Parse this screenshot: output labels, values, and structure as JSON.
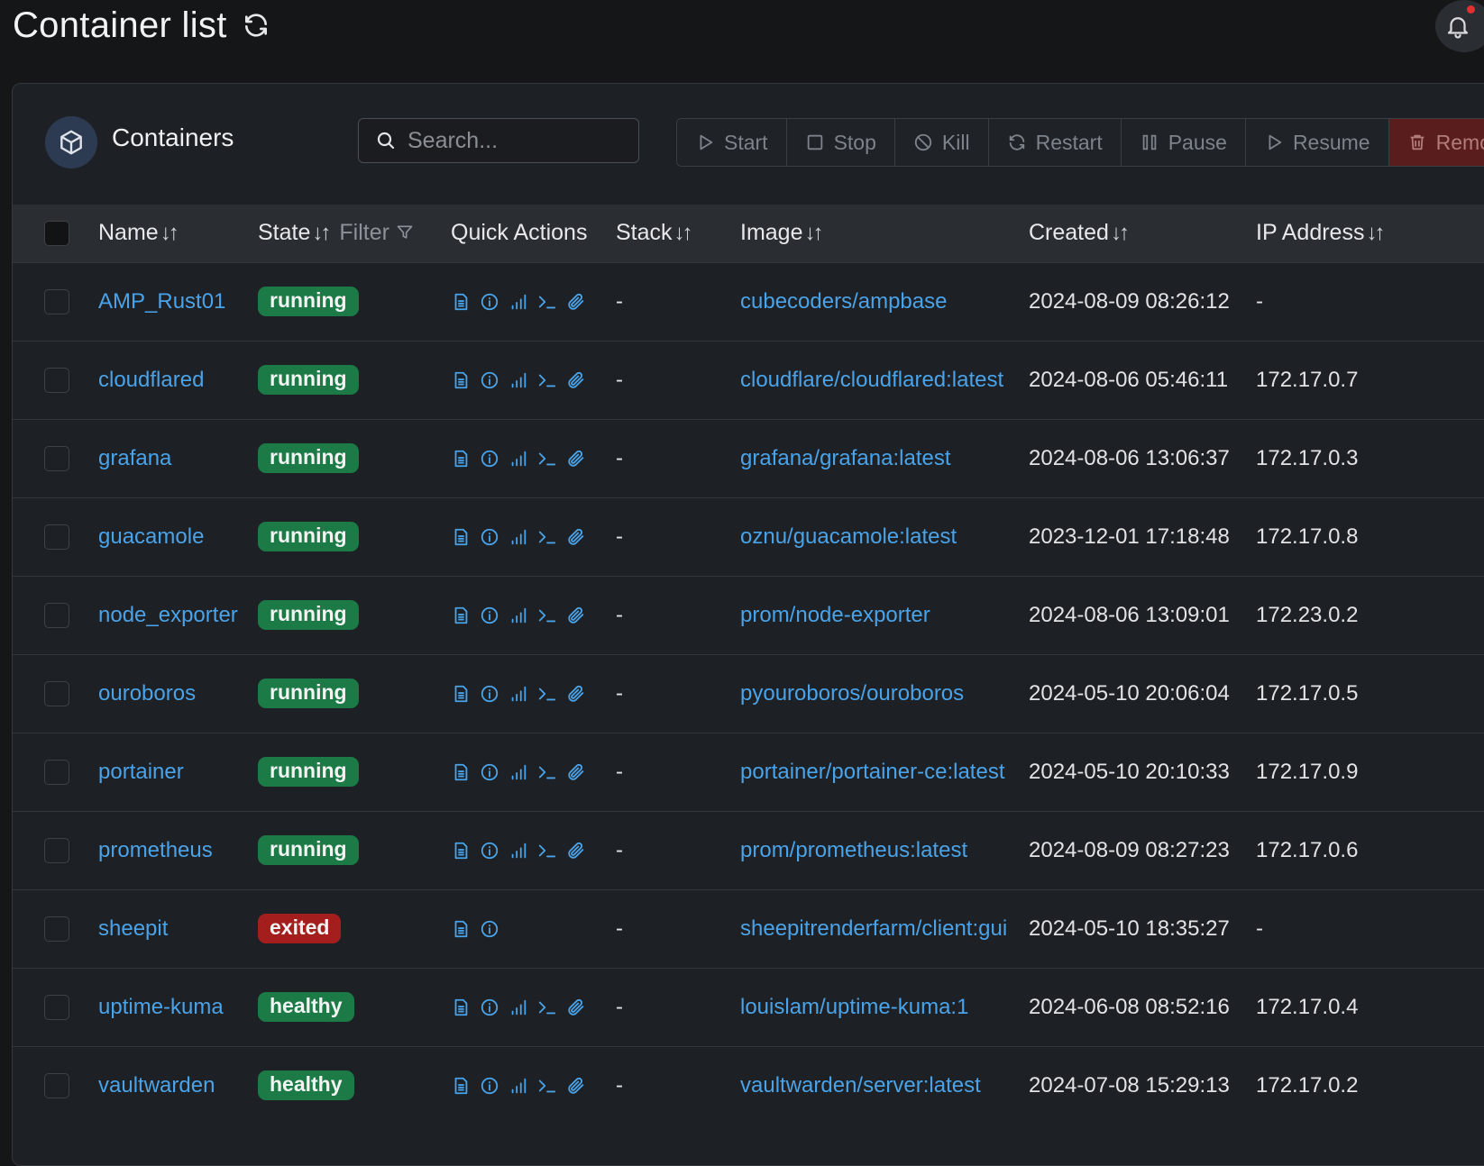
{
  "page": {
    "title": "Container list"
  },
  "panel": {
    "title": "Containers",
    "search": {
      "placeholder": "Search...",
      "value": ""
    },
    "actions": {
      "start": "Start",
      "stop": "Stop",
      "kill": "Kill",
      "restart": "Restart",
      "pause": "Pause",
      "resume": "Resume",
      "remove": "Remove"
    }
  },
  "columns": {
    "name": "Name",
    "state": "State",
    "filter": "Filter",
    "quick_actions": "Quick Actions",
    "stack": "Stack",
    "image": "Image",
    "created": "Created",
    "ip": "IP Address"
  },
  "containers": [
    {
      "name": "AMP_Rust01",
      "state": "running",
      "stack": "-",
      "image": "cubecoders/ampbase",
      "created": "2024-08-09 08:26:12",
      "ip": "-"
    },
    {
      "name": "cloudflared",
      "state": "running",
      "stack": "-",
      "image": "cloudflare/cloudflared:latest",
      "created": "2024-08-06 05:46:11",
      "ip": "172.17.0.7"
    },
    {
      "name": "grafana",
      "state": "running",
      "stack": "-",
      "image": "grafana/grafana:latest",
      "created": "2024-08-06 13:06:37",
      "ip": "172.17.0.3"
    },
    {
      "name": "guacamole",
      "state": "running",
      "stack": "-",
      "image": "oznu/guacamole:latest",
      "created": "2023-12-01 17:18:48",
      "ip": "172.17.0.8"
    },
    {
      "name": "node_exporter",
      "state": "running",
      "stack": "-",
      "image": "prom/node-exporter",
      "created": "2024-08-06 13:09:01",
      "ip": "172.23.0.2"
    },
    {
      "name": "ouroboros",
      "state": "running",
      "stack": "-",
      "image": "pyouroboros/ouroboros",
      "created": "2024-05-10 20:06:04",
      "ip": "172.17.0.5"
    },
    {
      "name": "portainer",
      "state": "running",
      "stack": "-",
      "image": "portainer/portainer-ce:latest",
      "created": "2024-05-10 20:10:33",
      "ip": "172.17.0.9"
    },
    {
      "name": "prometheus",
      "state": "running",
      "stack": "-",
      "image": "prom/prometheus:latest",
      "created": "2024-08-09 08:27:23",
      "ip": "172.17.0.6"
    },
    {
      "name": "sheepit",
      "state": "exited",
      "stack": "-",
      "image": "sheepitrenderfarm/client:gui",
      "created": "2024-05-10 18:35:27",
      "ip": "-"
    },
    {
      "name": "uptime-kuma",
      "state": "healthy",
      "stack": "-",
      "image": "louislam/uptime-kuma:1",
      "created": "2024-06-08 08:52:16",
      "ip": "172.17.0.4"
    },
    {
      "name": "vaultwarden",
      "state": "healthy",
      "stack": "-",
      "image": "vaultwarden/server:latest",
      "created": "2024-07-08 15:29:13",
      "ip": "172.17.0.2"
    }
  ],
  "colors": {
    "accent": "#4aa3e8",
    "running": "#1b7a45",
    "exited": "#a51e1e",
    "remove": "#5a1d1d"
  }
}
